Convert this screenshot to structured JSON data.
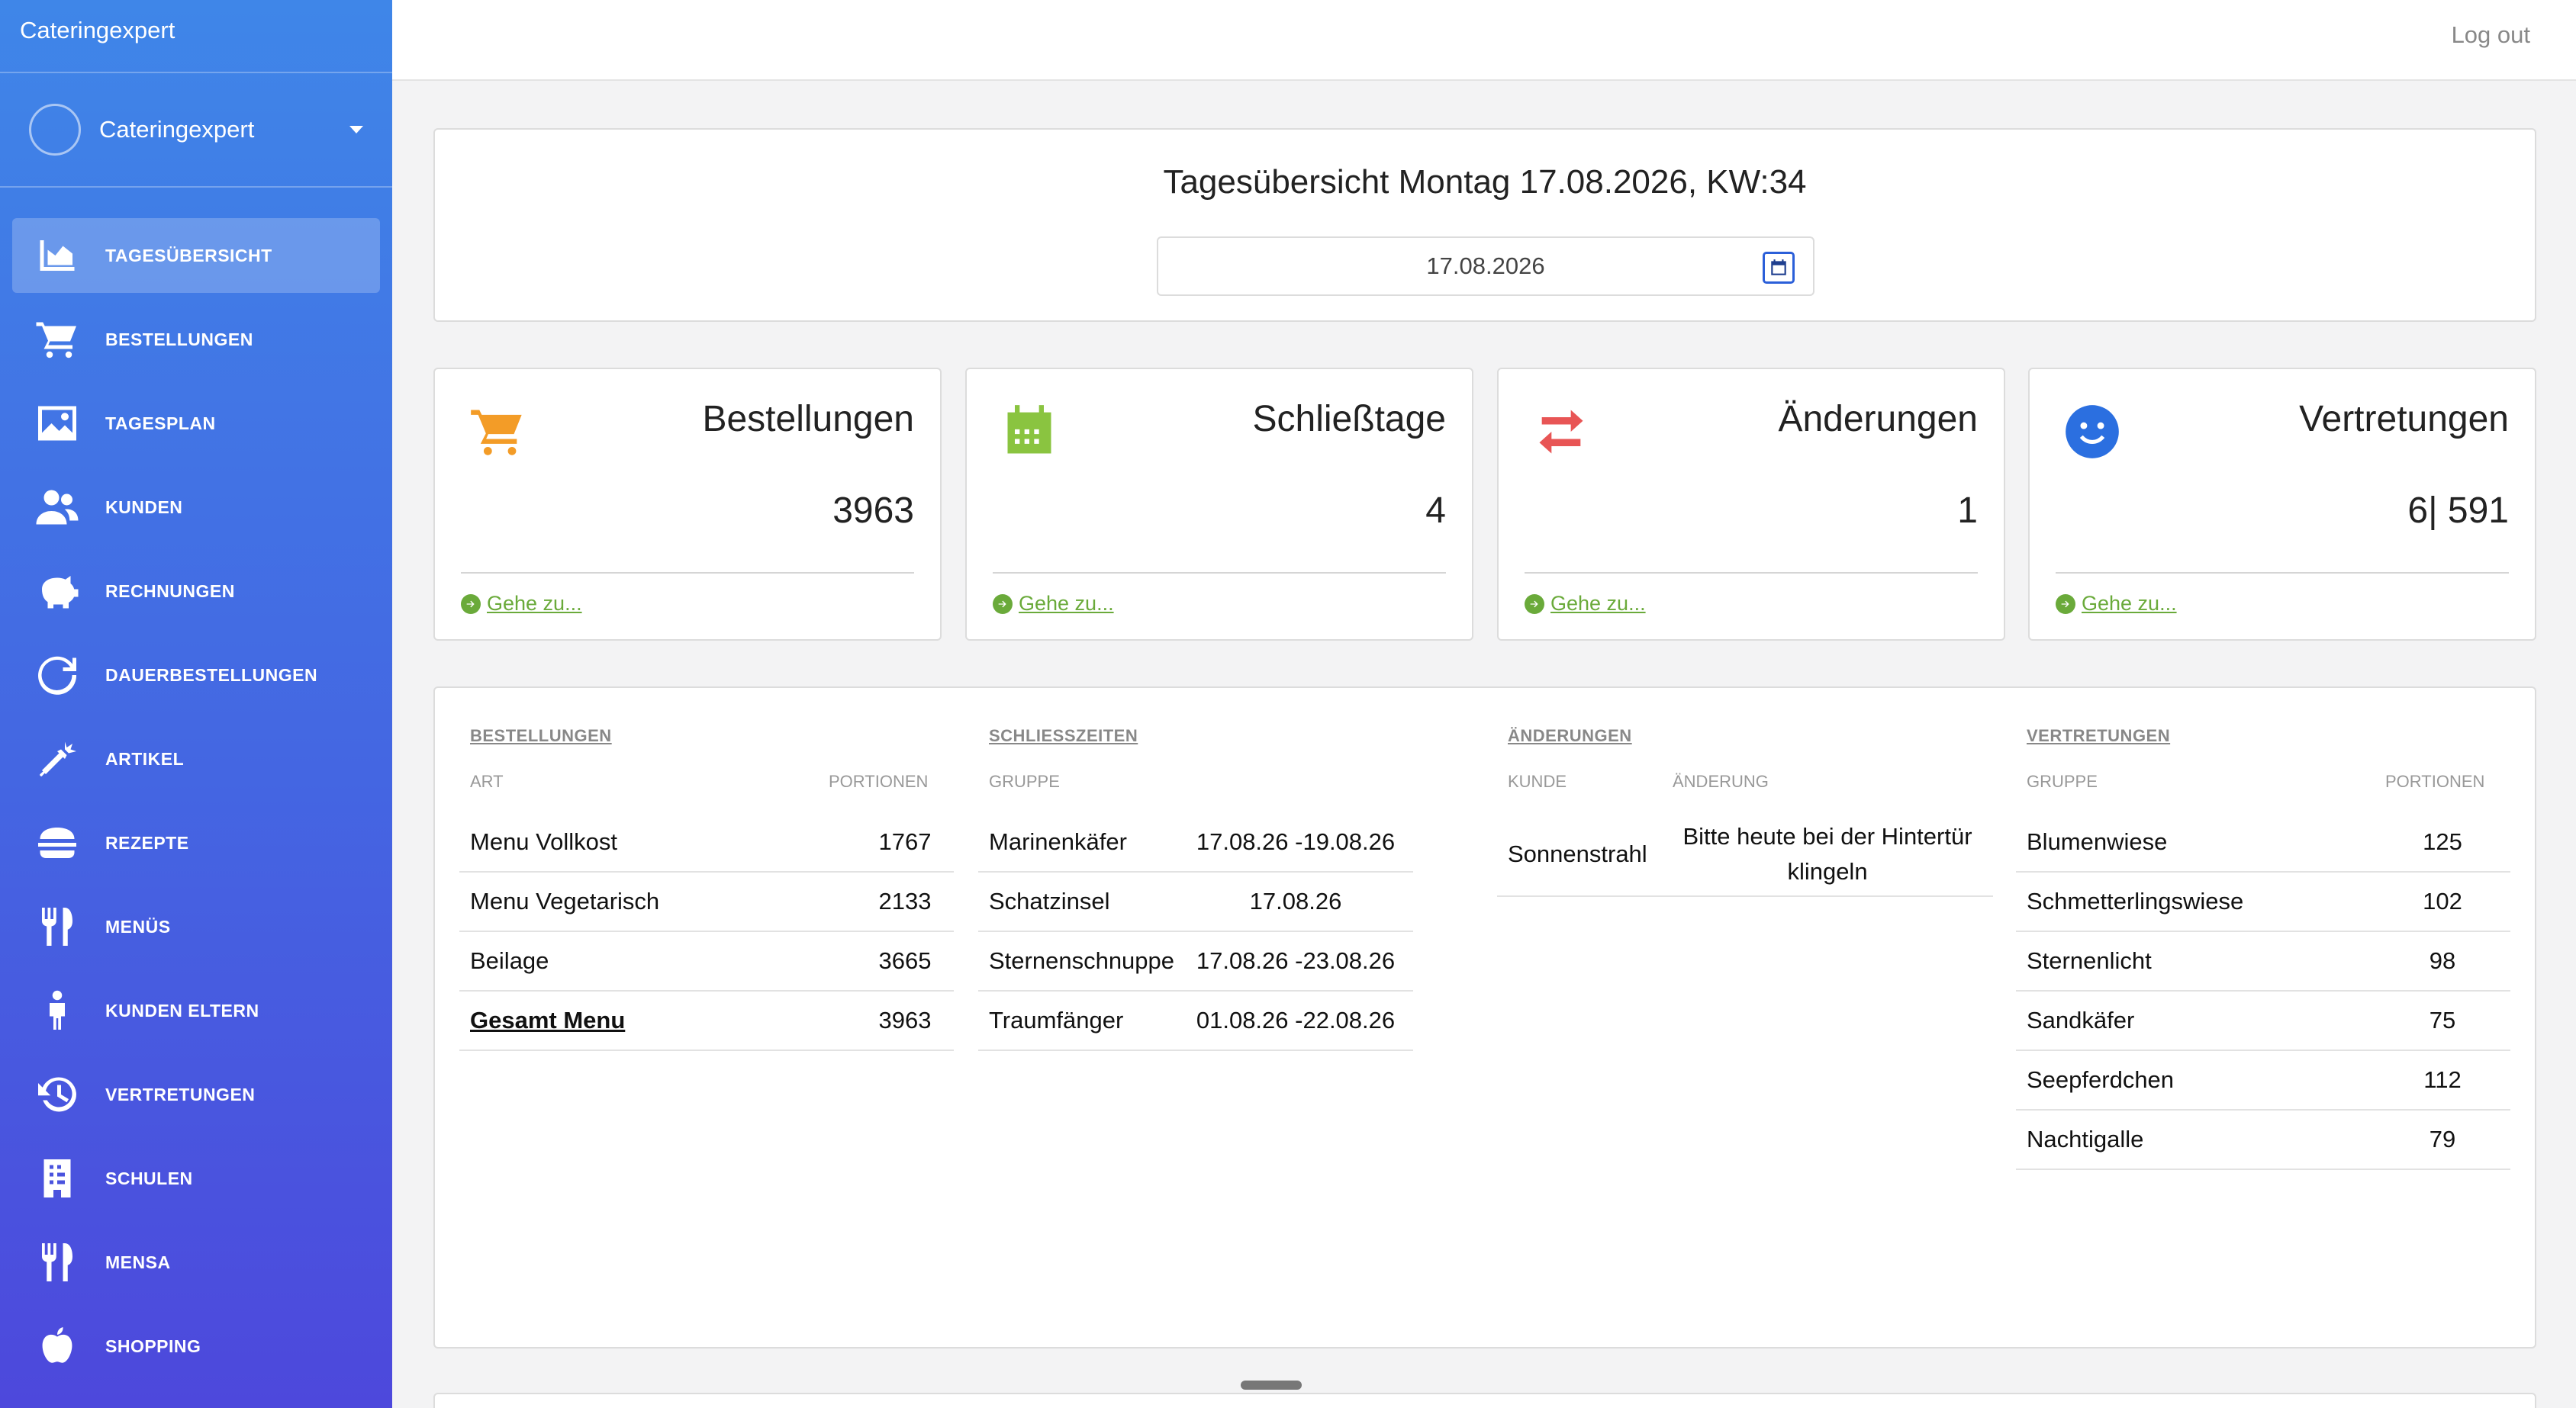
{
  "app": {
    "brand": "Cateringexpert",
    "user_name": "Cateringexpert",
    "logout": "Log out"
  },
  "sidebar": {
    "items": [
      {
        "label": "TAGESÜBERSICHT",
        "icon": "area-chart-icon",
        "active": true
      },
      {
        "label": "BESTELLUNGEN",
        "icon": "cart-icon"
      },
      {
        "label": "TAGESPLAN",
        "icon": "image-icon"
      },
      {
        "label": "KUNDEN",
        "icon": "users-icon"
      },
      {
        "label": "RECHNUNGEN",
        "icon": "piggy-bank-icon"
      },
      {
        "label": "DAUERBESTELLUNGEN",
        "icon": "refresh-icon"
      },
      {
        "label": "ARTIKEL",
        "icon": "carrot-icon"
      },
      {
        "label": "REZEPTE",
        "icon": "burger-icon"
      },
      {
        "label": "MENÜS",
        "icon": "cutlery-icon"
      },
      {
        "label": "KUNDEN ELTERN",
        "icon": "child-icon"
      },
      {
        "label": "VERTRETUNGEN",
        "icon": "history-icon"
      },
      {
        "label": "SCHULEN",
        "icon": "building-icon"
      },
      {
        "label": "MENSA",
        "icon": "cutlery-icon"
      },
      {
        "label": "SHOPPING",
        "icon": "apple-icon"
      }
    ]
  },
  "header": {
    "title": "Tagesübersicht Montag 17.08.2026, KW:34",
    "date_value": "17.08.2026"
  },
  "stats": {
    "bestellungen": {
      "title": "Bestellungen",
      "value": "3963",
      "link": "Gehe zu...",
      "color": "#f39c27"
    },
    "schliesstage": {
      "title": "Schließtage",
      "value": "4",
      "link": "Gehe zu...",
      "color": "#8ac440"
    },
    "aenderungen": {
      "title": "Änderungen",
      "value": "1",
      "link": "Gehe zu...",
      "color": "#e85555"
    },
    "vertretungen": {
      "title": "Vertretungen",
      "value": "6| 591",
      "link": "Gehe zu...",
      "color": "#2b6fe0"
    }
  },
  "tables": {
    "bestellungen": {
      "heading": "BESTELLUNGEN",
      "columns": [
        "ART",
        "PORTIONEN"
      ],
      "rows": [
        [
          "Menu Vollkost",
          "1767"
        ],
        [
          "Menu Vegetarisch",
          "2133"
        ],
        [
          "Beilage",
          "3665"
        ],
        [
          "Gesamt Menu",
          "3963"
        ]
      ]
    },
    "schliesszeiten": {
      "heading": "SCHLIESSZEITEN",
      "columns": [
        "GRUPPE",
        ""
      ],
      "rows": [
        [
          "Marinenkäfer",
          "17.08.26 -19.08.26"
        ],
        [
          "Schatzinsel",
          "17.08.26"
        ],
        [
          "Sternenschnuppe",
          "17.08.26 -23.08.26"
        ],
        [
          "Traumfänger",
          "01.08.26 -22.08.26"
        ]
      ]
    },
    "aenderungen": {
      "heading": "ÄNDERUNGEN",
      "columns": [
        "KUNDE",
        "ÄNDERUNG"
      ],
      "rows": [
        [
          "Sonnenstrahl",
          "Bitte heute bei der Hintertür klingeln"
        ]
      ]
    },
    "vertretungen": {
      "heading": "VERTRETUNGEN",
      "columns": [
        "GRUPPE",
        "PORTIONEN"
      ],
      "rows": [
        [
          "Blumenwiese",
          "125"
        ],
        [
          "Schmetterlingswiese",
          "102"
        ],
        [
          "Sternenlicht",
          "98"
        ],
        [
          "Sandkäfer",
          "75"
        ],
        [
          "Seepferdchen",
          "112"
        ],
        [
          "Nachtigalle",
          "79"
        ]
      ]
    }
  }
}
